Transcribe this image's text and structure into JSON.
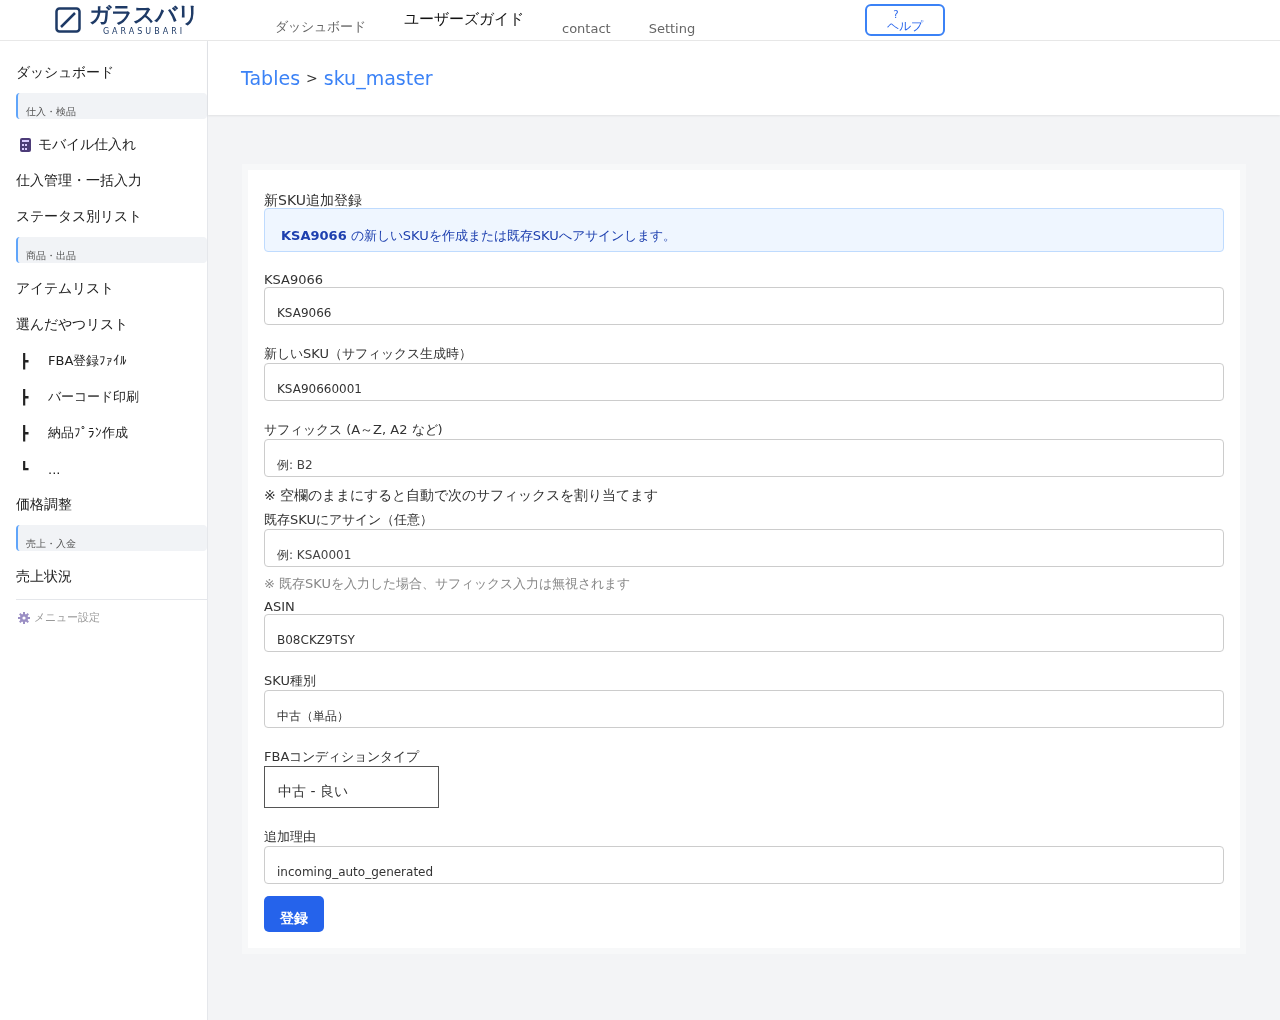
{
  "header": {
    "logo": {
      "name": "ガラスバリ",
      "sub": "GARASUBARI"
    },
    "nav": [
      {
        "label": "ダッシュボード",
        "selected": false
      },
      {
        "label": "ユーザーズガイド",
        "selected": true
      },
      {
        "label": "contact",
        "selected": false
      },
      {
        "label": "Setting",
        "selected": false
      }
    ],
    "help": {
      "mark": "?",
      "label": "ヘルプ"
    }
  },
  "sidebar": {
    "items": [
      {
        "kind": "item",
        "label": "ダッシュボード"
      },
      {
        "kind": "group",
        "label": "仕入・検品"
      },
      {
        "kind": "app",
        "label": "モバイル仕入れ"
      },
      {
        "kind": "item",
        "label": "仕入管理・一括入力"
      },
      {
        "kind": "item",
        "label": "ステータス別リスト"
      },
      {
        "kind": "group",
        "label": "商品・出品"
      },
      {
        "kind": "item",
        "label": "アイテムリスト"
      },
      {
        "kind": "item",
        "label": "選んだやつリスト"
      },
      {
        "kind": "branch",
        "mark": "┣",
        "label": "FBA登録ﾌｧｲﾙ"
      },
      {
        "kind": "branch",
        "mark": "┣",
        "label": "バーコード印刷"
      },
      {
        "kind": "branch",
        "mark": "┣",
        "label": "納品ﾌﾟﾗﾝ作成"
      },
      {
        "kind": "branch",
        "mark": "┗",
        "label": "..."
      },
      {
        "kind": "item",
        "label": "価格調整"
      },
      {
        "kind": "group",
        "label": "売上・入金"
      },
      {
        "kind": "item",
        "label": "売上状況"
      }
    ],
    "settings": "メニュー設定"
  },
  "breadcrumb": {
    "parent": "Tables",
    "separator": ">",
    "current": "sku_master"
  },
  "form": {
    "title": "新SKU追加登録",
    "info": "**KSA9066** の新しいSKUを作成または既存SKUへアサインします。",
    "items": [
      {
        "kind": "field",
        "label": "KSA9066",
        "value": "KSA9066"
      },
      {
        "kind": "field",
        "label": "新しいSKU（サフィックス生成時）",
        "value": "KSA90660001"
      },
      {
        "kind": "field",
        "label": "サフィックス (A～Z, A2 など)",
        "placeholder": "例: B2"
      },
      {
        "kind": "note",
        "text": "※ 空欄のままにすると自動で次のサフィックスを割り当てます"
      },
      {
        "kind": "field",
        "label": "既存SKUにアサイン（任意）",
        "placeholder": "例: KSA0001"
      },
      {
        "kind": "hint",
        "text": "※ 既存SKUを入力した場合、サフィックス入力は無視されます"
      },
      {
        "kind": "field",
        "label": "ASIN",
        "value": "B08CKZ9TSY"
      },
      {
        "kind": "field",
        "label": "SKU種別",
        "value": "中古（単品）"
      },
      {
        "kind": "select",
        "label": "FBAコンディションタイプ",
        "value": "中古 - 良い"
      },
      {
        "kind": "field",
        "label": "追加理由",
        "value": "incoming_auto_generated"
      }
    ],
    "submit": "登録"
  }
}
